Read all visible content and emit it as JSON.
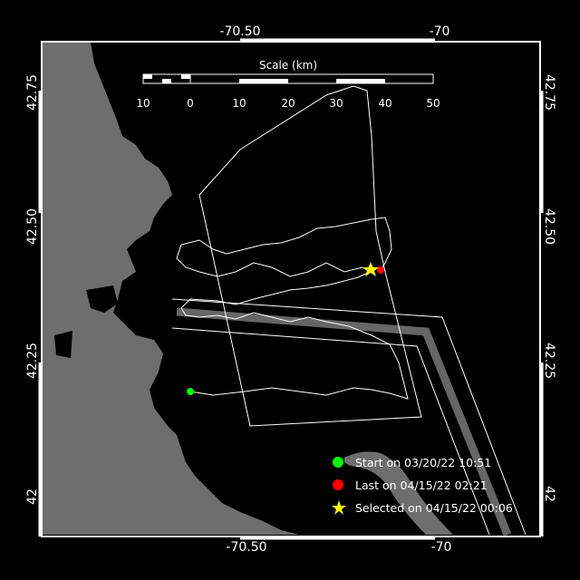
{
  "map": {
    "top_lon_labels": [
      "-70.50",
      "-70"
    ],
    "bottom_lon_labels": [
      "-70.50",
      "-70"
    ],
    "left_lat_labels": [
      "42.75",
      "42.50",
      "42.25",
      "42"
    ],
    "right_lat_labels": [
      "42.75",
      "42.50",
      "42.25",
      "42"
    ]
  },
  "scale": {
    "title": "Scale (km)",
    "ticks": [
      "10",
      "0",
      "10",
      "20",
      "30",
      "40",
      "50"
    ]
  },
  "legend": {
    "start": {
      "label": "Start on 03/20/22 10:51",
      "color": "#00ff00"
    },
    "last": {
      "label": "Last on 04/15/22 02:21",
      "color": "#ff0000"
    },
    "selected": {
      "label": "Selected on 04/15/22 00:06",
      "color": "#ffff00"
    }
  },
  "colors": {
    "land": "#6e6e6e",
    "water": "#000000",
    "track": "#ffffff",
    "frame": "#ffffff"
  }
}
